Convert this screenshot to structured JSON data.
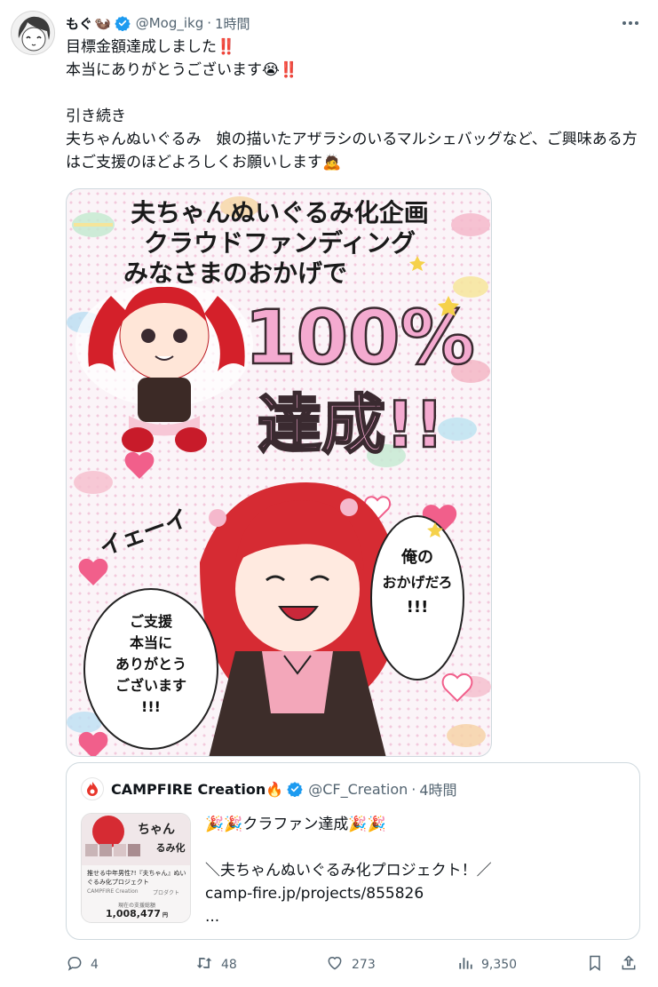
{
  "tweet": {
    "display_name": "もぐ",
    "name_emoji": "🦦",
    "handle": "@Mog_ikg",
    "separator": "·",
    "time": "1時間",
    "line1": "目標金額達成しました",
    "line1_mark": "‼️",
    "line2": "本当にありがとうございます",
    "line2_emoji": "😭",
    "line2_mark": "‼️",
    "line3": "引き続き",
    "line4": "夫ちゃんぬいぐるみ　娘の描いたアザラシのいるマルシェバッグなど、ご興味ある方はご支援のほどよろしくお願いします",
    "line4_emoji": "🙇"
  },
  "media": {
    "heading_1": "夫ちゃんぬいぐるみ化企画",
    "heading_2": "クラウドファンディング",
    "heading_3": "みなさまのおかげで",
    "percent": "100%",
    "achieved": "達成!!",
    "ie": "イェーイ",
    "bubble_right": "俺の\nおかげだろ!!!",
    "bubble_left": "ご支援\n本当に\nありがとう\nございます!!!"
  },
  "quote": {
    "name": "CAMPFIRE Creation",
    "name_emoji": "🔥",
    "handle": "@CF_Creation",
    "separator": "·",
    "time": "4時間",
    "line1": "🎉🎉クラファン達成🎉🎉",
    "line2": "＼夫ちゃんぬいぐるみ化プロジェクト！／",
    "line3": "camp-fire.jp/projects/855826",
    "line4": "...",
    "thumb_title": "推せる中年男性?!『夫ちゃん』ぬいぐるみ化プロジェクト",
    "thumb_brand": "CAMPFIRE Creation",
    "thumb_tag": "プロダクト",
    "thumb_label": "現在の支援総額",
    "thumb_amount": "1,008,477",
    "thumb_unit": "円"
  },
  "actions": {
    "replies": "4",
    "reposts": "48",
    "likes": "273",
    "views": "9,350"
  },
  "colors": {
    "verified": "#1d9bf0",
    "text": "#0f1419",
    "muted": "#536471",
    "accent_red": "#d6162a",
    "border": "#cfd9de"
  },
  "icons": [
    "avatar",
    "verified-badge-icon",
    "more-icon",
    "reply-icon",
    "repost-icon",
    "like-icon",
    "views-icon",
    "bookmark-icon",
    "share-icon",
    "campfire-logo-icon"
  ]
}
